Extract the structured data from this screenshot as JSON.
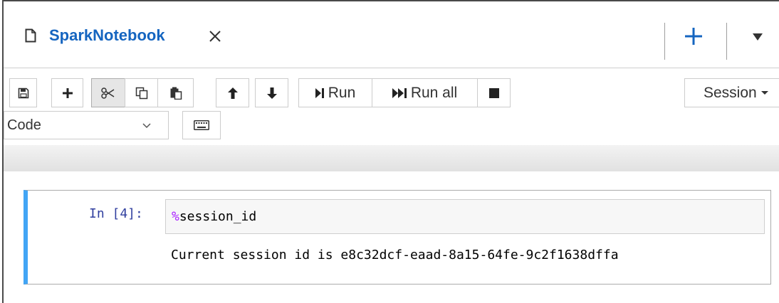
{
  "tab": {
    "title": "SparkNotebook"
  },
  "toolbar": {
    "run_label": "Run",
    "run_all_label": "Run all",
    "session_label": "Session"
  },
  "cell_type_select": {
    "selected": "Code"
  },
  "cell": {
    "prompt": "In [4]:",
    "input_magic_prefix": "%",
    "input_command": "session_id",
    "output": "Current session id is e8c32dcf-eaad-8a15-64fe-9c2f1638dffa"
  },
  "colors": {
    "tab_title": "#1565c0",
    "add_button": "#1565c0",
    "cell_accent": "#42a5f5",
    "prompt": "#303f9f",
    "magic": "#aa22ff"
  },
  "icons": {
    "tab": "document-icon",
    "close": "close-icon",
    "add": "plus-icon",
    "menu": "caret-down-icon"
  }
}
